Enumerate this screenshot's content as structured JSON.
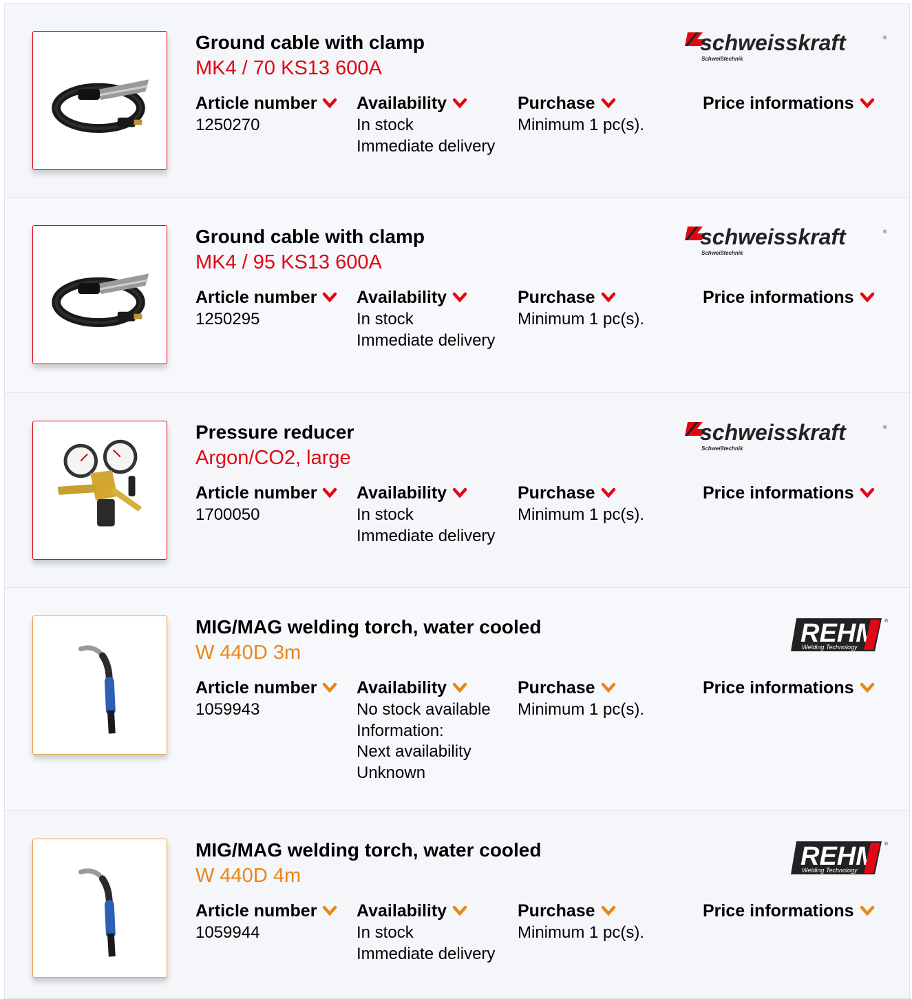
{
  "products": [
    {
      "title": "Ground cable with clamp",
      "model": "MK4 / 70 KS13 600A",
      "accent": "#e30613",
      "image": "ground-cable-clamp",
      "brand": {
        "name": "schweisskraft",
        "tagline": "Schweißtechnik"
      },
      "article_label": "Article number",
      "article_number": "1250270",
      "availability_label": "Availability",
      "availability": [
        "In stock",
        "Immediate delivery"
      ],
      "purchase_label": "Purchase",
      "purchase": "Minimum 1 pc(s).",
      "price_label": "Price informations"
    },
    {
      "title": "Ground cable with clamp",
      "model": "MK4 / 95 KS13 600A",
      "accent": "#e30613",
      "image": "ground-cable-clamp",
      "brand": {
        "name": "schweisskraft",
        "tagline": "Schweißtechnik"
      },
      "article_label": "Article number",
      "article_number": "1250295",
      "availability_label": "Availability",
      "availability": [
        "In stock",
        "Immediate delivery"
      ],
      "purchase_label": "Purchase",
      "purchase": "Minimum 1 pc(s).",
      "price_label": "Price informations"
    },
    {
      "title": "Pressure reducer",
      "model": "Argon/CO2, large",
      "accent": "#e30613",
      "image": "pressure-reducer",
      "brand": {
        "name": "schweisskraft",
        "tagline": "Schweißtechnik"
      },
      "article_label": "Article number",
      "article_number": "1700050",
      "availability_label": "Availability",
      "availability": [
        "In stock",
        "Immediate delivery"
      ],
      "purchase_label": "Purchase",
      "purchase": "Minimum 1 pc(s).",
      "price_label": "Price informations"
    },
    {
      "title": "MIG/MAG welding torch, water cooled",
      "model": "W 440D 3m",
      "accent": "#e8861a",
      "image": "welding-torch",
      "brand": {
        "name": "REHM",
        "tagline": "Welding Technology"
      },
      "article_label": "Article number",
      "article_number": "1059943",
      "availability_label": "Availability",
      "availability": [
        "No stock available",
        "Information:",
        "Next availability",
        "Unknown"
      ],
      "purchase_label": "Purchase",
      "purchase": "Minimum 1 pc(s).",
      "price_label": "Price informations"
    },
    {
      "title": "MIG/MAG welding torch, water cooled",
      "model": "W 440D 4m",
      "accent": "#e8861a",
      "image": "welding-torch",
      "brand": {
        "name": "REHM",
        "tagline": "Welding Technology"
      },
      "article_label": "Article number",
      "article_number": "1059944",
      "availability_label": "Availability",
      "availability": [
        "In stock",
        "Immediate delivery"
      ],
      "purchase_label": "Purchase",
      "purchase": "Minimum 1 pc(s).",
      "price_label": "Price informations"
    }
  ]
}
